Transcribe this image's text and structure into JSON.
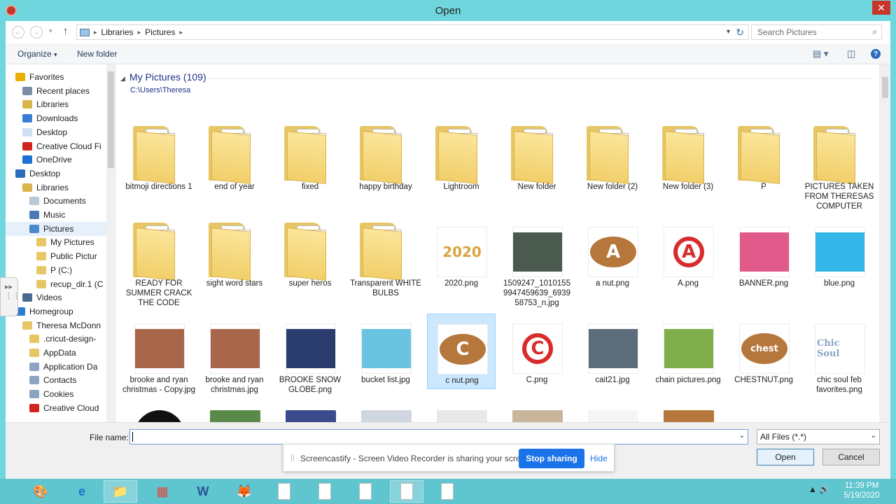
{
  "window": {
    "title": "Open",
    "close_glyph": "✕"
  },
  "address": {
    "segments": [
      "Libraries",
      "Pictures"
    ],
    "search_placeholder": "Search Pictures"
  },
  "toolbar": {
    "organize": "Organize",
    "new_folder": "New folder"
  },
  "nav": [
    {
      "label": "Favorites",
      "icon": "star-icon",
      "color": "#e8b000"
    },
    {
      "label": "Recent places",
      "icon": "recent-icon",
      "color": "#7b8ea6"
    },
    {
      "label": "Libraries",
      "icon": "library-icon",
      "color": "#d9b54c"
    },
    {
      "label": "Downloads",
      "icon": "downloads-icon",
      "color": "#3a7bd5"
    },
    {
      "label": "Desktop",
      "icon": "desktop-icon",
      "color": "#cfe0f2"
    },
    {
      "label": "Creative Cloud Fi",
      "icon": "creative-cloud-icon",
      "color": "#d2241f"
    },
    {
      "label": "OneDrive",
      "icon": "onedrive-icon",
      "color": "#1e6fd6"
    },
    {
      "label": "Desktop",
      "icon": "desktop-icon",
      "color": "#2d6dbd"
    },
    {
      "label": "Libraries",
      "icon": "library-icon",
      "color": "#d9b54c"
    },
    {
      "label": "Documents",
      "icon": "documents-icon",
      "color": "#b9c7d6"
    },
    {
      "label": "Music",
      "icon": "music-icon",
      "color": "#4a7ab8"
    },
    {
      "label": "Pictures",
      "icon": "pictures-icon",
      "color": "#4d88c9"
    },
    {
      "label": "My Pictures",
      "icon": "folder-icon",
      "color": "#e7c765"
    },
    {
      "label": "Public Pictur",
      "icon": "folder-icon",
      "color": "#e7c765"
    },
    {
      "label": "P (C:)",
      "icon": "folder-icon",
      "color": "#e7c765"
    },
    {
      "label": "recup_dir.1 (C",
      "icon": "folder-icon",
      "color": "#e7c765"
    },
    {
      "label": "Videos",
      "icon": "videos-icon",
      "color": "#4a6a90"
    },
    {
      "label": "Homegroup",
      "icon": "homegroup-icon",
      "color": "#2f7bd0"
    },
    {
      "label": "Theresa McDonn",
      "icon": "user-folder-icon",
      "color": "#e7c765"
    },
    {
      "label": ".cricut-design-",
      "icon": "folder-icon",
      "color": "#e7c765"
    },
    {
      "label": "AppData",
      "icon": "folder-icon",
      "color": "#e7c765"
    },
    {
      "label": "Application Da",
      "icon": "folder-icon",
      "color": "#8aa4c2"
    },
    {
      "label": "Contacts",
      "icon": "contacts-icon",
      "color": "#8aa4c2"
    },
    {
      "label": "Cookies",
      "icon": "cookies-icon",
      "color": "#8aa4c2"
    },
    {
      "label": "Creative Cloud",
      "icon": "creative-cloud-icon",
      "color": "#d2241f"
    }
  ],
  "group": {
    "title": "My Pictures (109)",
    "path": "C:\\Users\\Theresa"
  },
  "items": [
    {
      "label": "bitmoji directions 1",
      "kind": "folder"
    },
    {
      "label": "end of year",
      "kind": "folder"
    },
    {
      "label": "fixed",
      "kind": "folder"
    },
    {
      "label": "happy birthday",
      "kind": "folder"
    },
    {
      "label": "Lightroom",
      "kind": "folder"
    },
    {
      "label": "New folder",
      "kind": "folder"
    },
    {
      "label": "New folder (2)",
      "kind": "folder"
    },
    {
      "label": "New folder (3)",
      "kind": "folder"
    },
    {
      "label": "P",
      "kind": "folder"
    },
    {
      "label": "PICTURES TAKEN FROM THERESAS COMPUTER",
      "kind": "folder"
    },
    {
      "label": "READY FOR SUMMER CRACK THE CODE",
      "kind": "folder"
    },
    {
      "label": "sight word stars",
      "kind": "folder"
    },
    {
      "label": "super heros",
      "kind": "folder"
    },
    {
      "label": "Transparent WHITE BULBS",
      "kind": "folder"
    },
    {
      "label": "2020.png",
      "kind": "image",
      "art": "2020",
      "color": "#d9a441"
    },
    {
      "label": "1509247_1010155 9947459639_6939 58753_n.jpg",
      "kind": "image",
      "color": "#4b5a4e"
    },
    {
      "label": "a nut.png",
      "kind": "image",
      "art": "A",
      "color": "#b5773b"
    },
    {
      "label": "A.png",
      "kind": "image",
      "art": "A",
      "color": "#d92b2b"
    },
    {
      "label": "BANNER.png",
      "kind": "image",
      "color": "#e05a8a"
    },
    {
      "label": "blue.png",
      "kind": "image",
      "color": "#33b5e8"
    },
    {
      "label": "brooke and ryan christmas - Copy.jpg",
      "kind": "image",
      "color": "#a8664a"
    },
    {
      "label": "brooke and ryan christmas.jpg",
      "kind": "image",
      "color": "#a8664a"
    },
    {
      "label": "BROOKE SNOW GLOBE.png",
      "kind": "image",
      "color": "#2b3d6e"
    },
    {
      "label": "bucket list.jpg",
      "kind": "image",
      "color": "#6ac3e0"
    },
    {
      "label": "c nut.png",
      "kind": "image",
      "art": "C",
      "color": "#b5773b",
      "selected": true
    },
    {
      "label": "C.png",
      "kind": "image",
      "art": "C",
      "color": "#d92b2b"
    },
    {
      "label": "cait21.jpg",
      "kind": "image",
      "color": "#5d6c7a"
    },
    {
      "label": "chain pictures.png",
      "kind": "image",
      "color": "#7fae4a"
    },
    {
      "label": "CHESTNUT.png",
      "kind": "image",
      "art": "chest",
      "color": "#b5773b"
    },
    {
      "label": "chic soul feb favorites.png",
      "kind": "image",
      "art": "Chic Soul",
      "color": "#8ba3c7"
    }
  ],
  "partial_row": [
    {
      "color": "#111111"
    },
    {
      "color": "#5a8a4a"
    },
    {
      "color": "#3b4a8a"
    },
    {
      "color": "#cfd6df"
    },
    {
      "color": "#e8e8e8"
    },
    {
      "color": "#c9b69a"
    },
    {
      "color": "#f5f5f5"
    },
    {
      "color": "#b5773b"
    }
  ],
  "filename": {
    "label": "File name:",
    "value": ""
  },
  "filetype": {
    "selected": "All Files (*.*)"
  },
  "buttons": {
    "open": "Open",
    "cancel": "Cancel"
  },
  "screencast": {
    "message": "Screencastify - Screen Video Recorder is sharing your screen.",
    "stop": "Stop sharing",
    "hide": "Hide"
  },
  "taskbar": {
    "apps": [
      "paint-icon",
      "internet-explorer-icon",
      "file-explorer-icon",
      "app-grid-icon",
      "word-icon",
      "firefox-icon",
      "document-icon",
      "document-icon",
      "document-icon",
      "document-icon",
      "document-icon"
    ],
    "time": "11:39 PM",
    "date": "5/19/2020"
  }
}
